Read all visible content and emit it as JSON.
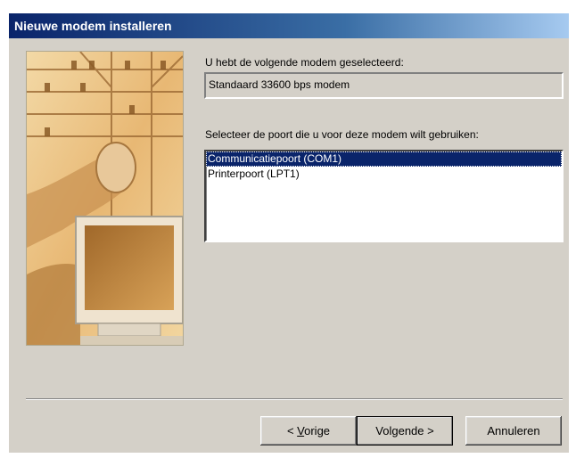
{
  "window": {
    "title": "Nieuwe modem installeren"
  },
  "modem": {
    "label": "U hebt de volgende modem geselecteerd:",
    "value": "Standaard 33600 bps modem"
  },
  "port": {
    "label": "Selecteer de poort die u voor deze modem wilt gebruiken:",
    "options": [
      "Communicatiepoort (COM1)",
      "Printerpoort (LPT1)"
    ],
    "selected_index": 0
  },
  "buttons": {
    "back_pre": "< ",
    "back_mnemonic": "V",
    "back_post": "orige",
    "next": "Volgende >",
    "cancel": "Annuleren"
  },
  "colors": {
    "title_start": "#0a246a",
    "title_end": "#a6caf0",
    "face": "#d4d0c8",
    "selection": "#0a246a"
  }
}
